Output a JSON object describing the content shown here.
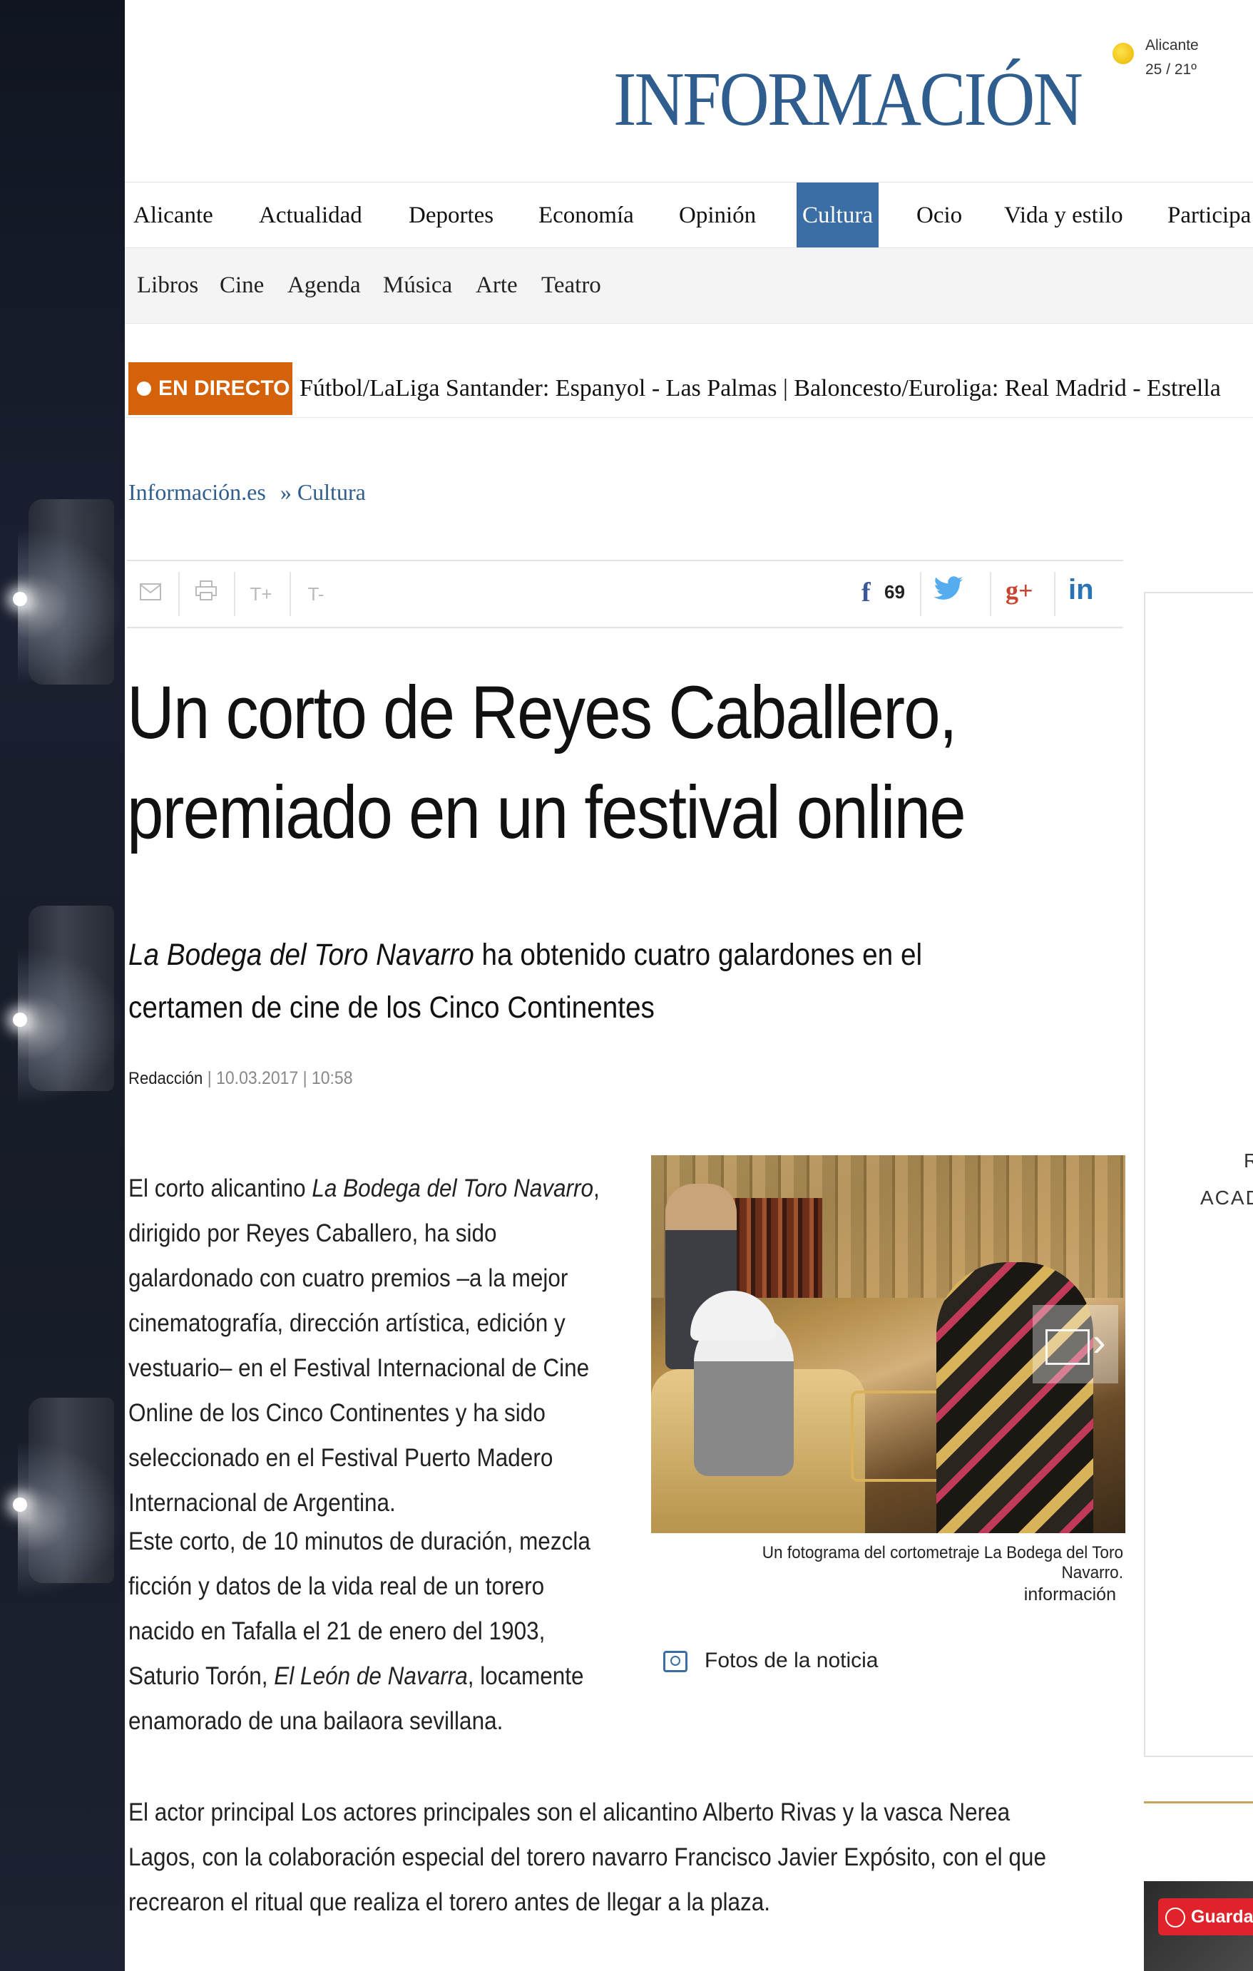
{
  "header": {
    "logo": "INFORMACIÓN",
    "weather": {
      "city": "Alicante",
      "temp": "25 / 21º",
      "icon": "sun-icon"
    }
  },
  "main_nav": [
    "Alicante",
    "Actualidad",
    "Deportes",
    "Economía",
    "Opinión",
    "Cultura",
    "Ocio",
    "Vida y estilo",
    "Participa"
  ],
  "main_nav_active": "Cultura",
  "sub_nav": [
    "Libros",
    "Cine",
    "Agenda",
    "Música",
    "Arte",
    "Teatro"
  ],
  "ticker": {
    "badge": "EN DIRECTO",
    "text": "Fútbol/LaLiga Santander: Espanyol - Las Palmas  | Baloncesto/Euroliga: Real Madrid - Estrella"
  },
  "breadcrumb": {
    "home": "Información.es",
    "section": "» Cultura"
  },
  "tools": {
    "email_icon": "envelope-icon",
    "print_icon": "printer-icon",
    "font_up": "T+",
    "font_down": "T-",
    "facebook_count": "69",
    "facebook_glyph": "f",
    "google_glyph": "g+",
    "linkedin_glyph": "in"
  },
  "article": {
    "headline_line1": "Un corto de Reyes Caballero,",
    "headline_line2": "premiado en un festival online",
    "subheadline_italic": "La Bodega del Toro Navarro",
    "subheadline_rest": " ha obtenido cuatro galardones en el certamen de cine de los Cinco Continentes",
    "author": "Redacción",
    "date": "| 10.03.2017 | 10:58",
    "p1_a": "El corto alicantino ",
    "p1_italic": "La Bodega del Toro Navarro",
    "p1_b": ", dirigido por Reyes Caballero, ha sido galardonado con cuatro premios –a la mejor cinematografía, dirección artística, edición y vestuario– en el Festival Internacional de Cine Online de los Cinco Continentes y ha sido seleccionado en el Festival Puerto Madero Internacional de Argentina.",
    "p2_a": "Este corto, de 10 minutos de duración, mezcla ficción y datos de la vida real de un torero nacido en Tafalla el 21 de enero del 1903, Saturio Torón, ",
    "p2_italic": "El León de Navarra",
    "p2_b": ", locamente enamorado de una bailaora sevillana.",
    "p3": "El actor principal Los actores principales son el alicantino Alberto Rivas y la vasca Nerea Lagos, con la colaboración especial del torero navarro Francisco Javier Expósito, con el que recrearon el ritual que realiza el torero antes de llegar a la plaza."
  },
  "photo": {
    "caption": "Un fotograma del cortometraje La Bodega del Toro Navarro.",
    "credit": "información",
    "gallery_link": "Fotos de la noticia"
  },
  "sidebar": {
    "text1": "R",
    "text2": "ACAD",
    "save_button": "Guardar"
  },
  "colors": {
    "brand": "#2f5e8e",
    "active_nav": "#3a6ea5",
    "live": "#d4620a",
    "facebook": "#3b5998",
    "twitter": "#55acee",
    "google": "#c8462f",
    "linkedin": "#2a74b4",
    "pinterest": "#e0232b"
  }
}
